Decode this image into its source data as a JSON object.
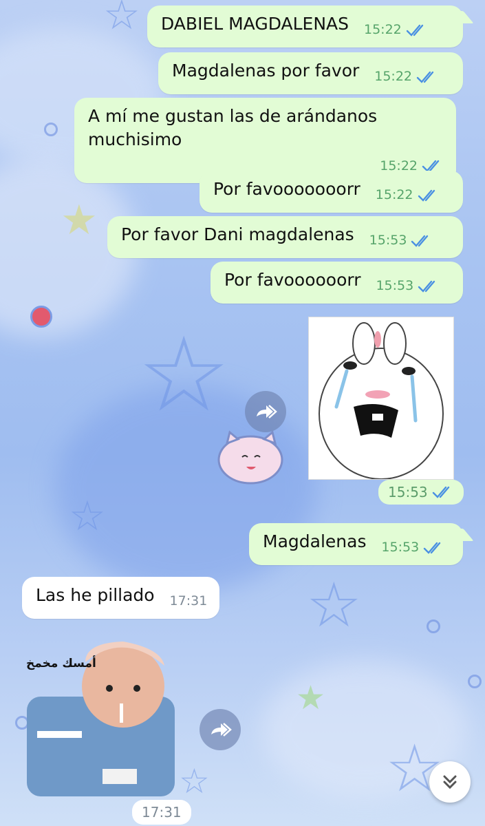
{
  "messages": [
    {
      "text": "DABIEL MAGDALENAS",
      "time": "15:22"
    },
    {
      "text": "Magdalenas por favor",
      "time": "15:22"
    },
    {
      "text": "A mí me gustan las de arándanos muchisimo",
      "time": "15:22"
    },
    {
      "text": "Por favooooooorr",
      "time": "15:22"
    },
    {
      "text": "Por favor Dani magdalenas",
      "time": "15:53"
    },
    {
      "text": "Por favoooooorr",
      "time": "15:53"
    },
    {
      "text": "Magdalenas",
      "time": "15:53"
    }
  ],
  "sticker_out": {
    "time": "15:53",
    "icon": "crying-rabbit-sticker"
  },
  "incoming": {
    "text": "Las he pillado",
    "time": "17:31"
  },
  "sticker_in": {
    "caption": "أمسك مخمخ",
    "time": "17:31",
    "icon": "baby-smoking-sticker"
  },
  "colors": {
    "outgoing": "#e2fcd5",
    "incoming": "#ffffff",
    "ticks": "#4a90e2"
  }
}
